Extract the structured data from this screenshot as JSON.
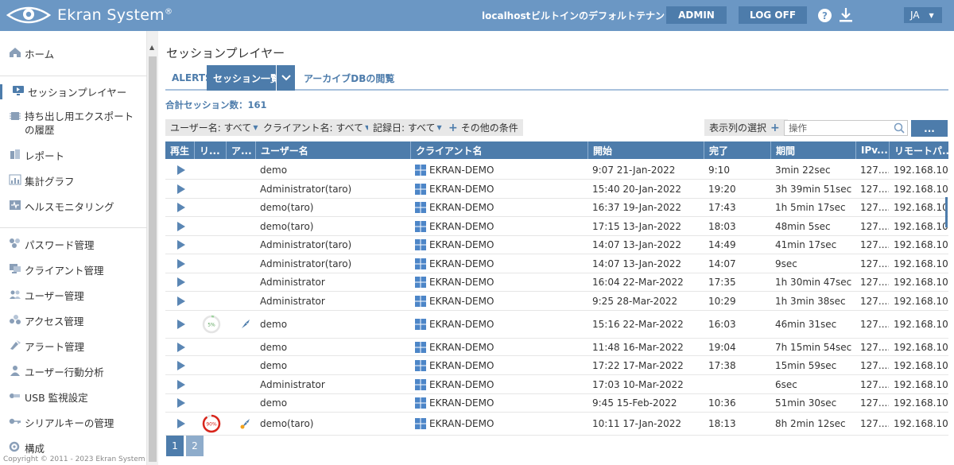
{
  "header": {
    "brand": "Ekran System",
    "brand_mark": "®",
    "host": "localhost",
    "tenant": "ビルトインのデフォルトテナント",
    "admin_label": "ADMIN",
    "logoff_label": "LOG OFF",
    "help_label": "?",
    "language": "JA",
    "language_caret": "▼"
  },
  "sidebar": {
    "items": [
      {
        "label": "ホーム",
        "icon": "home-icon"
      },
      {
        "label": "セッションプレイヤー",
        "icon": "monitor-icon"
      },
      {
        "label": "持ち出し用エクスポートの履歴",
        "icon": "chip-icon"
      },
      {
        "label": "レポート",
        "icon": "report-icon"
      },
      {
        "label": "集計グラフ",
        "icon": "chart-icon"
      },
      {
        "label": "ヘルスモニタリング",
        "icon": "health-icon"
      },
      {
        "label": "パスワード管理",
        "icon": "key-icon"
      },
      {
        "label": "クライアント管理",
        "icon": "computer-icon"
      },
      {
        "label": "ユーザー管理",
        "icon": "users-icon"
      },
      {
        "label": "アクセス管理",
        "icon": "access-icon"
      },
      {
        "label": "アラート管理",
        "icon": "alert-icon"
      },
      {
        "label": "ユーザー行動分析",
        "icon": "behavior-icon"
      },
      {
        "label": "USB 監視設定",
        "icon": "usb-icon"
      },
      {
        "label": "シリアルキーの管理",
        "icon": "serial-key-icon"
      },
      {
        "label": "構成",
        "icon": "config-icon"
      }
    ],
    "copyright": "Copyright © 2011 - 2023 Ekran System"
  },
  "main": {
    "title": "セッションプレイヤー",
    "tabs": [
      {
        "label": "ALERTS"
      },
      {
        "label": "セッション一覧"
      },
      {
        "label": "アーカイブDBの閲覧"
      }
    ],
    "total_sessions": "合計セッション数：161",
    "filters": [
      {
        "label": "ユーザー名: すべて"
      },
      {
        "label": "クライアント名: すべて"
      },
      {
        "label": "記録日: すべて"
      }
    ],
    "more_conditions": "その他の条件",
    "column_select": "表示列の選択",
    "search": {
      "placeholder": "操作"
    },
    "more_button": "..."
  },
  "table": {
    "headers": [
      "再生",
      "リ...",
      "ア...",
      "ユーザー名",
      "クライアント名",
      "開始",
      "完了",
      "期間",
      "IPv...",
      "リモートパ..."
    ],
    "rows": [
      {
        "user": "demo",
        "client": "EKRAN-DEMO",
        "start": "9:07 21-Jan-2022",
        "end": "9:10",
        "duration": "3min 22sec",
        "ip": "127....",
        "remote": "192.168.10...."
      },
      {
        "user": "Administrator(taro)",
        "client": "EKRAN-DEMO",
        "start": "15:40 20-Jan-2022",
        "end": "19:20",
        "duration": "3h 39min 51sec",
        "ip": "127....",
        "remote": "192.168.10...."
      },
      {
        "user": "demo(taro)",
        "client": "EKRAN-DEMO",
        "start": "16:37 19-Jan-2022",
        "end": "17:43",
        "duration": "1h 5min 17sec",
        "ip": "127....",
        "remote": "192.168.10...."
      },
      {
        "user": "demo(taro)",
        "client": "EKRAN-DEMO",
        "start": "17:15 13-Jan-2022",
        "end": "18:03",
        "duration": "48min 5sec",
        "ip": "127....",
        "remote": "192.168.10...."
      },
      {
        "user": "Administrator(taro)",
        "client": "EKRAN-DEMO",
        "start": "14:07 13-Jan-2022",
        "end": "14:49",
        "duration": "41min 17sec",
        "ip": "127....",
        "remote": "192.168.10...."
      },
      {
        "user": "Administrator(taro)",
        "client": "EKRAN-DEMO",
        "start": "14:07 13-Jan-2022",
        "end": "14:07",
        "duration": "9sec",
        "ip": "127....",
        "remote": "192.168.10...."
      },
      {
        "user": "Administrator",
        "client": "EKRAN-DEMO",
        "start": "16:04 22-Mar-2022",
        "end": "17:35",
        "duration": "1h 30min 47sec",
        "ip": "127....",
        "remote": "192.168.10...."
      },
      {
        "user": "Administrator",
        "client": "EKRAN-DEMO",
        "start": "9:25 28-Mar-2022",
        "end": "10:29",
        "duration": "1h 3min 38sec",
        "ip": "127....",
        "remote": "192.168.10...."
      },
      {
        "user": "demo",
        "client": "EKRAN-DEMO",
        "start": "15:16 22-Mar-2022",
        "end": "16:03",
        "duration": "46min 31sec",
        "ip": "127....",
        "remote": "192.168.10....",
        "risk": "5%",
        "risk_value": 5,
        "risk_color": "#9fd39f",
        "alert_icon": "rocket-icon"
      },
      {
        "user": "demo",
        "client": "EKRAN-DEMO",
        "start": "11:48 16-Mar-2022",
        "end": "19:04",
        "duration": "7h 15min 54sec",
        "ip": "127....",
        "remote": "192.168.10...."
      },
      {
        "user": "demo",
        "client": "EKRAN-DEMO",
        "start": "17:22 17-Mar-2022",
        "end": "17:38",
        "duration": "15min 59sec",
        "ip": "127....",
        "remote": "192.168.10...."
      },
      {
        "user": "Administrator",
        "client": "EKRAN-DEMO",
        "start": "17:03 10-Mar-2022",
        "end": "",
        "duration": "6sec",
        "ip": "127....",
        "remote": "192.168.10...."
      },
      {
        "user": "demo",
        "client": "EKRAN-DEMO",
        "start": "9:45 15-Feb-2022",
        "end": "10:36",
        "duration": "51min 30sec",
        "ip": "127....",
        "remote": "192.168.10...."
      },
      {
        "user": "demo(taro)",
        "client": "EKRAN-DEMO",
        "start": "10:11 17-Jan-2022",
        "end": "18:13",
        "duration": "8h 2min 12sec",
        "ip": "127....",
        "remote": "192.168.10....",
        "risk": "90%",
        "risk_value": 90,
        "risk_color": "#d9261c",
        "alert_icon": "rocket-fire-icon"
      }
    ]
  },
  "pagination": {
    "pages": [
      "1",
      "2"
    ],
    "current": "1"
  },
  "colors": {
    "brand": "#6b97c4",
    "accent": "#4d7cab",
    "header_dark": "#4d7cab"
  }
}
